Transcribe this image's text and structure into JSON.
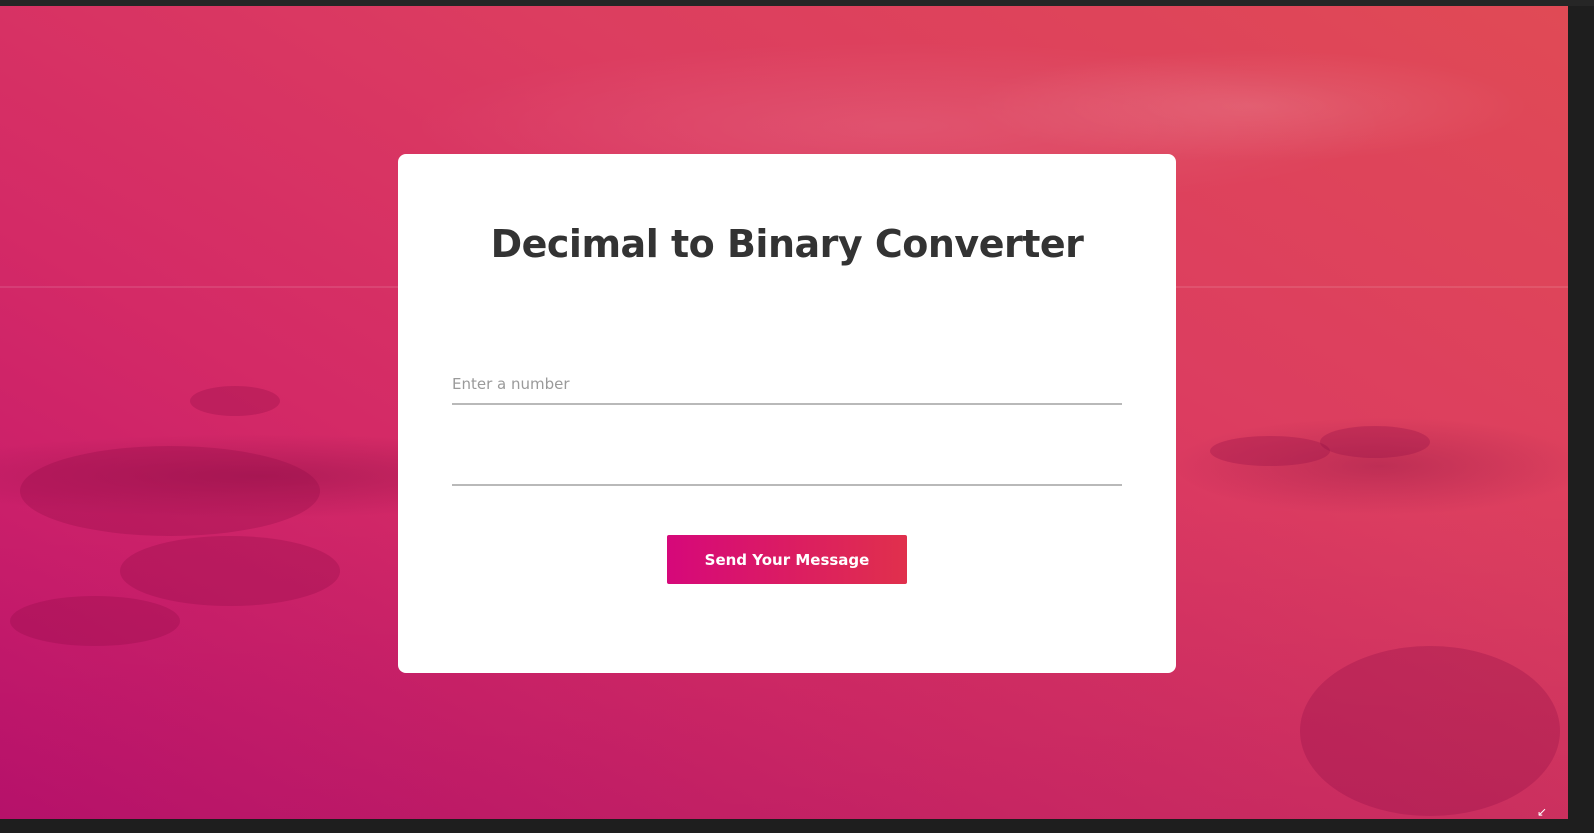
{
  "converter": {
    "title": "Decimal to Binary Converter",
    "number_input": {
      "placeholder": "Enter a number",
      "value": ""
    },
    "result_field": {
      "value": ""
    },
    "submit_label": "Send Your Message"
  },
  "window": {
    "resize_icon": "resize-corner-icon",
    "resize_glyph": "↙"
  },
  "colors": {
    "button_gradient_start": "#d6087a",
    "button_gradient_end": "#e0304c",
    "title_color": "#333333",
    "background_tint": "#d42a66"
  }
}
